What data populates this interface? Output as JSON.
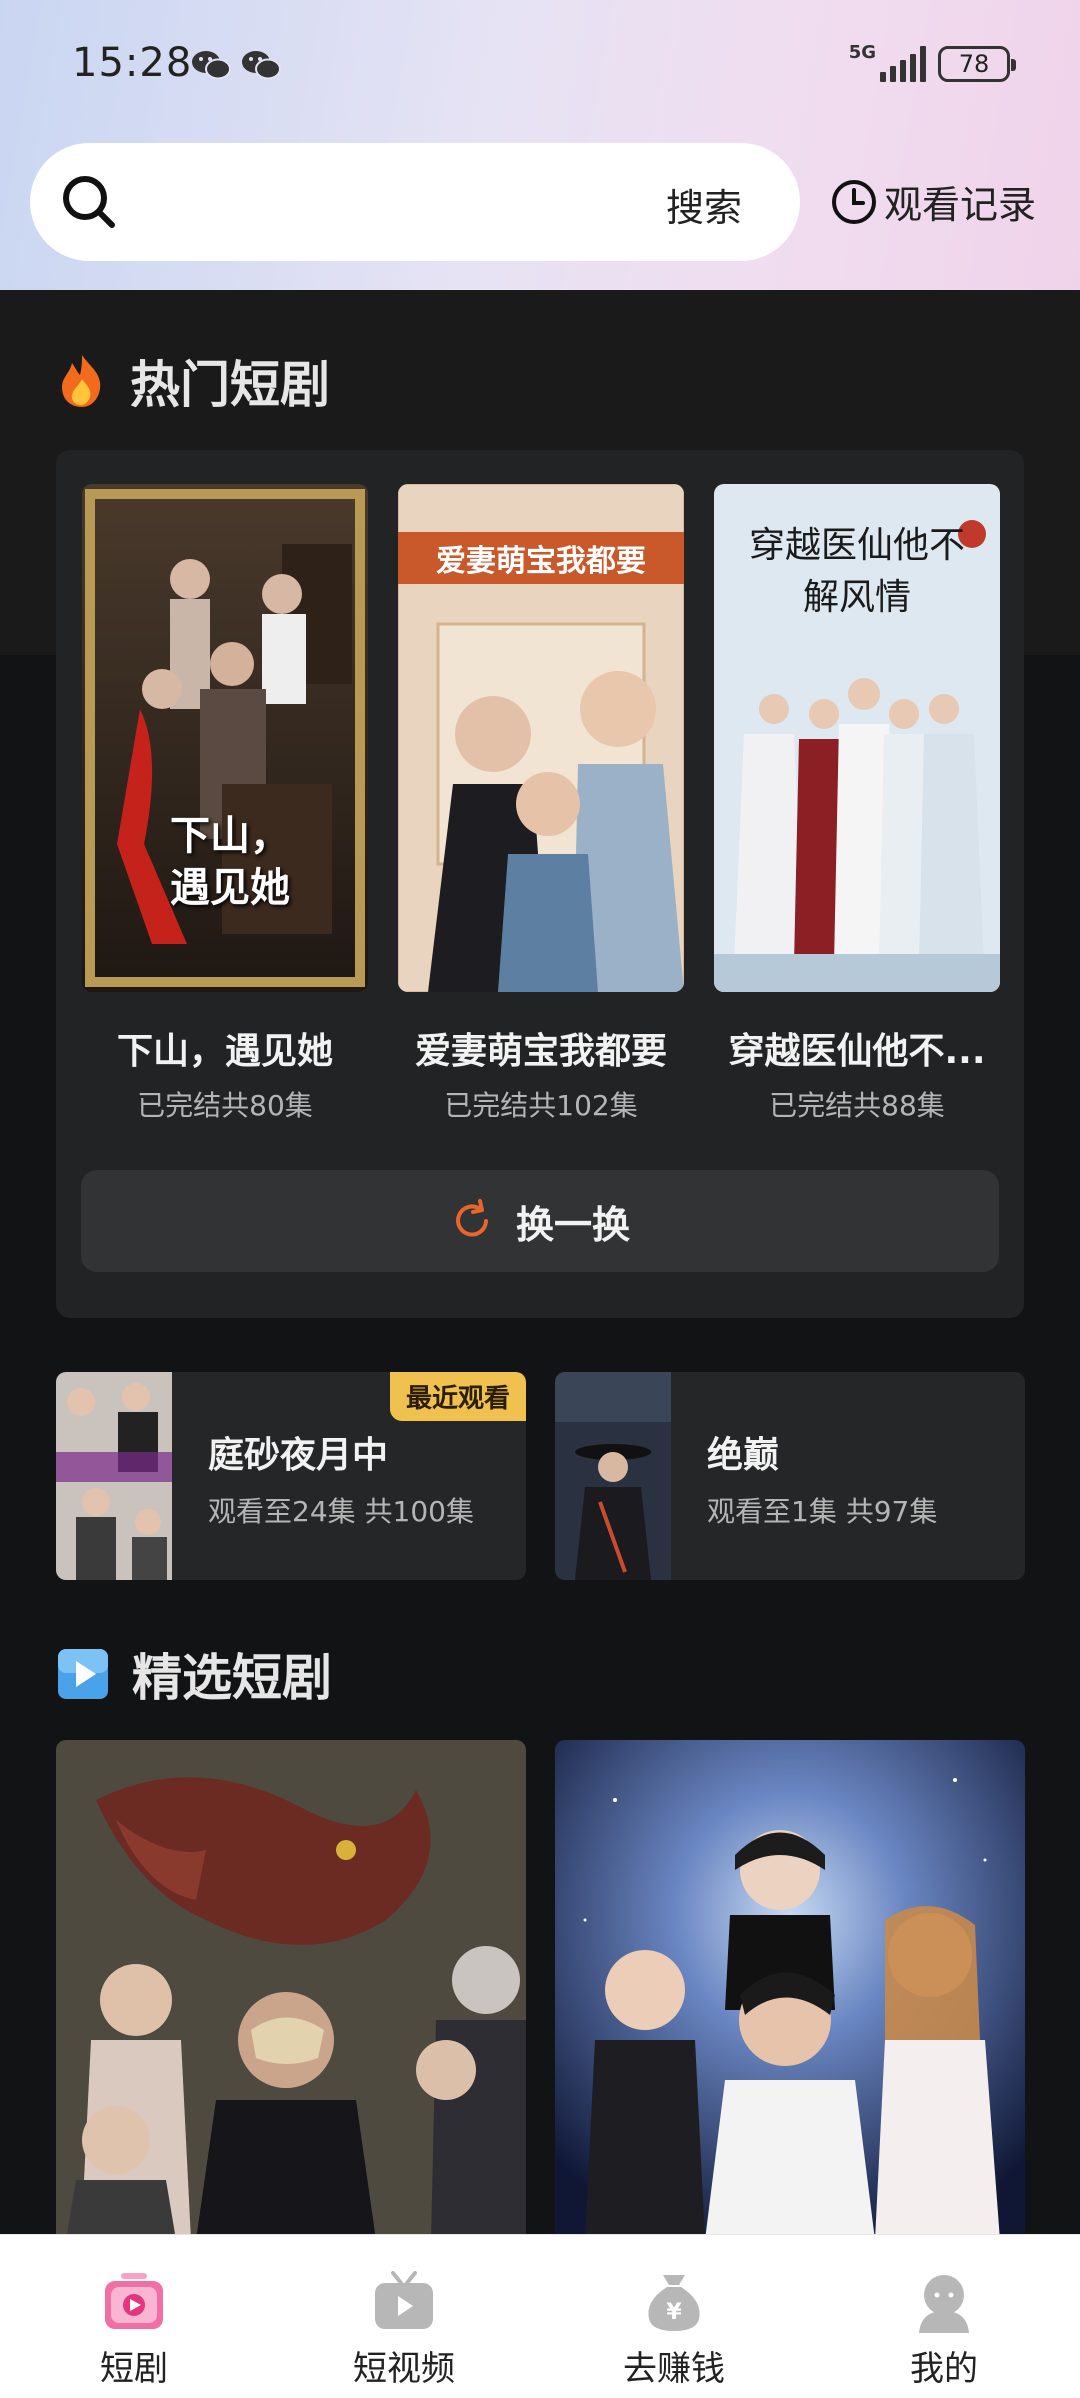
{
  "status": {
    "time": "15:28",
    "network": "5G",
    "battery": "78"
  },
  "search": {
    "button_label": "搜索"
  },
  "history": {
    "label": "观看记录"
  },
  "hot_section": {
    "title": "热门短剧",
    "items": [
      {
        "title": "下山，遇见她",
        "subtitle": "已完结共80集",
        "poster_text": "下山，\n遇见她"
      },
      {
        "title": "爱妻萌宝我都要",
        "subtitle": "已完结共102集",
        "poster_text": "爱妻萌宝我都要"
      },
      {
        "title": "穿越医仙他不...",
        "subtitle": "已完结共88集",
        "poster_text": "穿越医仙他不解风情"
      }
    ],
    "refresh_label": "换一换"
  },
  "recent": [
    {
      "title": "庭砂夜月中",
      "progress": "观看至24集 共100集",
      "badge": "最近观看"
    },
    {
      "title": "绝巅",
      "progress": "观看至1集 共97集"
    }
  ],
  "featured_section": {
    "title": "精选短剧"
  },
  "tabs": [
    {
      "label": "短剧",
      "icon": "drama-tab-icon"
    },
    {
      "label": "短视频",
      "icon": "tv-icon"
    },
    {
      "label": "去赚钱",
      "icon": "money-bag-icon"
    },
    {
      "label": "我的",
      "icon": "user-icon"
    }
  ]
}
